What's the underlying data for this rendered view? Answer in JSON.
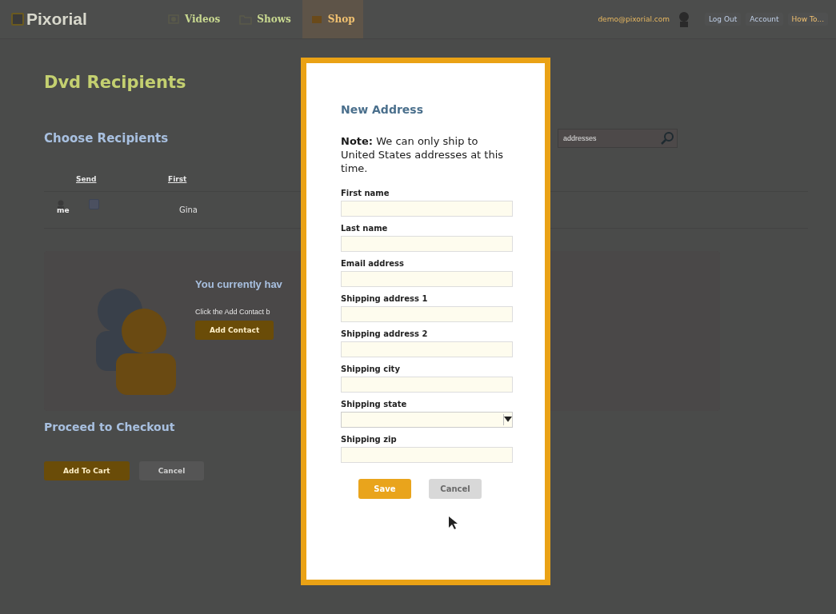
{
  "header": {
    "logo": "Pixorial",
    "nav": [
      {
        "label": "Videos",
        "selected": false
      },
      {
        "label": "Shows",
        "selected": false
      },
      {
        "label": "Shop",
        "selected": true
      }
    ],
    "user_email": "demo@pixorial.com",
    "links": [
      "Log Out",
      "Account",
      "How To..."
    ]
  },
  "page": {
    "title": "Dvd Recipients",
    "section": "Choose Recipients",
    "search": {
      "placeholder": "addresses"
    },
    "table": {
      "columns": [
        "Send",
        "First"
      ],
      "rows": [
        {
          "badge": "me",
          "checked": false,
          "first": "Gina"
        }
      ]
    },
    "empty": {
      "heading": "You currently hav",
      "text": "Click the Add Contact b",
      "button": "Add Contact"
    },
    "checkout": {
      "title": "Proceed to Checkout",
      "buttons": [
        {
          "label": "Add To Cart",
          "disabled": false
        },
        {
          "label": "Cancel",
          "disabled": true
        }
      ]
    }
  },
  "modal": {
    "title": "New Address",
    "note": "**Note:** We can only ship to United States addresses at this time.",
    "fields": [
      {
        "label": "First name",
        "kind": "text"
      },
      {
        "label": "Last name",
        "kind": "text"
      },
      {
        "label": "Email address",
        "kind": "text"
      },
      {
        "label": "Shipping address 1",
        "kind": "text"
      },
      {
        "label": "Shipping address 2",
        "kind": "text"
      },
      {
        "label": "Shipping city",
        "kind": "text"
      },
      {
        "label": "Shipping state",
        "kind": "select"
      },
      {
        "label": "Shipping zip",
        "kind": "text"
      }
    ],
    "buttons": [
      {
        "label": "Save",
        "disabled": false
      },
      {
        "label": "Cancel",
        "disabled": true
      }
    ]
  }
}
